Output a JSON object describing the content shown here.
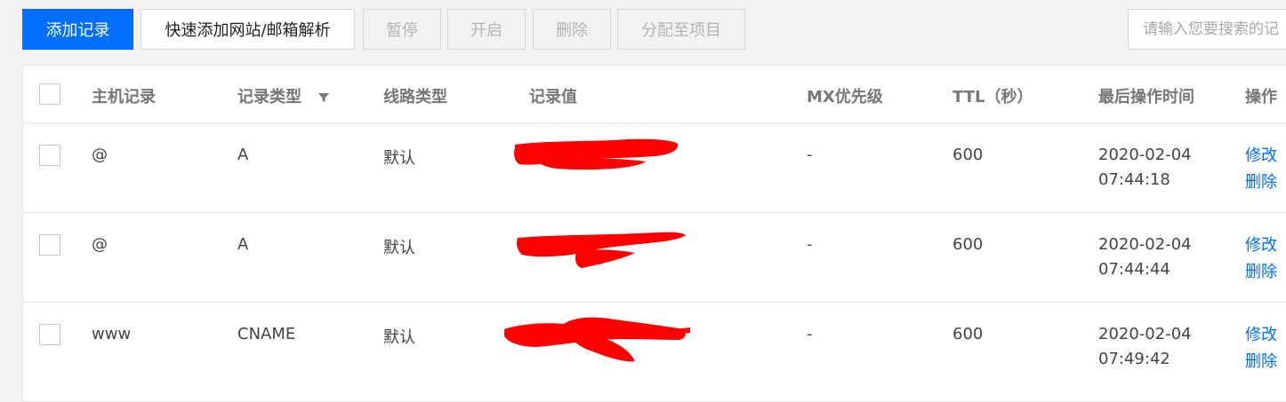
{
  "toolbar": {
    "add_record": "添加记录",
    "quick_add": "快速添加网站/邮箱解析",
    "pause": "暂停",
    "enable": "开启",
    "delete": "删除",
    "assign_project": "分配至项目",
    "search_placeholder": "请输入您要搜索的记"
  },
  "table": {
    "headers": {
      "host": "主机记录",
      "type": "记录类型",
      "line": "线路类型",
      "value": "记录值",
      "mx": "MX优先级",
      "ttl": "TTL（秒）",
      "time": "最后操作时间",
      "ops": "操作"
    },
    "rows": [
      {
        "host": "@",
        "type": "A",
        "line": "默认",
        "mx": "-",
        "ttl": "600",
        "date": "2020-02-04",
        "clock": "07:44:18",
        "edit": "修改",
        "delete": "删除"
      },
      {
        "host": "@",
        "type": "A",
        "line": "默认",
        "mx": "-",
        "ttl": "600",
        "date": "2020-02-04",
        "clock": "07:44:44",
        "edit": "修改",
        "delete": "删除"
      },
      {
        "host": "www",
        "type": "CNAME",
        "line": "默认",
        "mx": "-",
        "ttl": "600",
        "date": "2020-02-04",
        "clock": "07:49:42",
        "edit": "修改",
        "delete": "删除"
      }
    ]
  },
  "colors": {
    "primary": "#006eff",
    "redaction": "#ff0000"
  },
  "icons": {
    "filter": "filter-icon"
  }
}
